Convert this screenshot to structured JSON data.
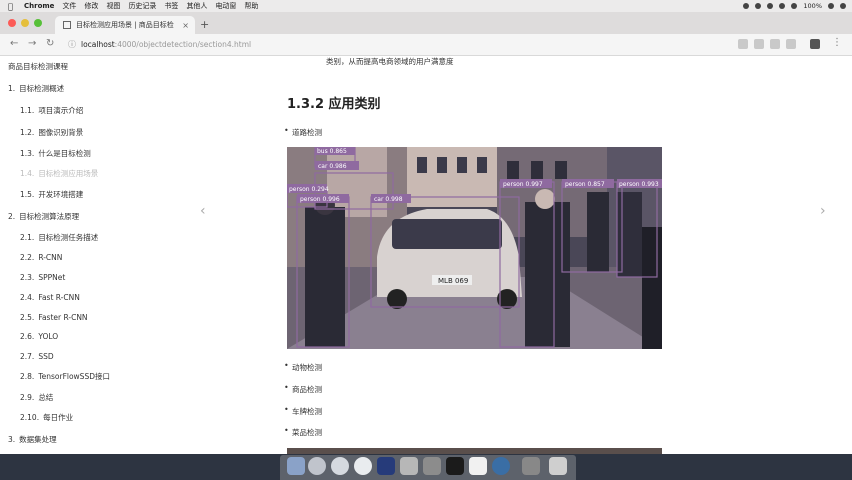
{
  "menubar": {
    "app": "Chrome",
    "items": [
      "文件",
      "修改",
      "视图",
      "历史记录",
      "书签",
      "其他人",
      "电动窗",
      "帮助"
    ],
    "battery": "100%"
  },
  "browser": {
    "tab_title": "目标检测应用场景 | 商品目标检",
    "url_host": "localhost",
    "url_rest": ":4000/objectdetection/section4.html"
  },
  "sidebar": {
    "title": "商品目标检测课程",
    "items": [
      {
        "num": "1.",
        "label": "目标检测概述"
      },
      {
        "num": "1.1.",
        "label": "项目演示介绍"
      },
      {
        "num": "1.2.",
        "label": "图像识别背景"
      },
      {
        "num": "1.3.",
        "label": "什么是目标检测"
      },
      {
        "num": "1.4.",
        "label": "目标检测应用场景"
      },
      {
        "num": "1.5.",
        "label": "开发环境搭建"
      },
      {
        "num": "2.",
        "label": "目标检测算法原理"
      },
      {
        "num": "2.1.",
        "label": "目标检测任务描述"
      },
      {
        "num": "2.2.",
        "label": "R-CNN"
      },
      {
        "num": "2.3.",
        "label": "SPPNet"
      },
      {
        "num": "2.4.",
        "label": "Fast R-CNN"
      },
      {
        "num": "2.5.",
        "label": "Faster R-CNN"
      },
      {
        "num": "2.6.",
        "label": "YOLO"
      },
      {
        "num": "2.7.",
        "label": "SSD"
      },
      {
        "num": "2.8.",
        "label": "TensorFlowSSD接口"
      },
      {
        "num": "2.9.",
        "label": "总结"
      },
      {
        "num": "2.10.",
        "label": "每日作业"
      },
      {
        "num": "3.",
        "label": "数据集处理"
      }
    ]
  },
  "content": {
    "top_line": "类别，从而提高电商领域的用户满意度",
    "heading": "1.3.2 应用类别",
    "bullet_top": "道路检测",
    "bullets": [
      "动物检测",
      "商品检测",
      "车牌检测",
      "菜品检测"
    ]
  },
  "detections": [
    {
      "label": "car 0.986"
    },
    {
      "label": "person 0.996"
    },
    {
      "label": "car 0.998"
    },
    {
      "label": "person 0.997"
    },
    {
      "label": "person 0.857"
    },
    {
      "label": "person 0.993"
    },
    {
      "label": "person 0.294"
    },
    {
      "label": "bus 0.865"
    }
  ],
  "plate": "MLB 069",
  "colors": {
    "accent": "#333333",
    "dock": "#2d3441",
    "photo_dark": "#3b3a4a"
  }
}
